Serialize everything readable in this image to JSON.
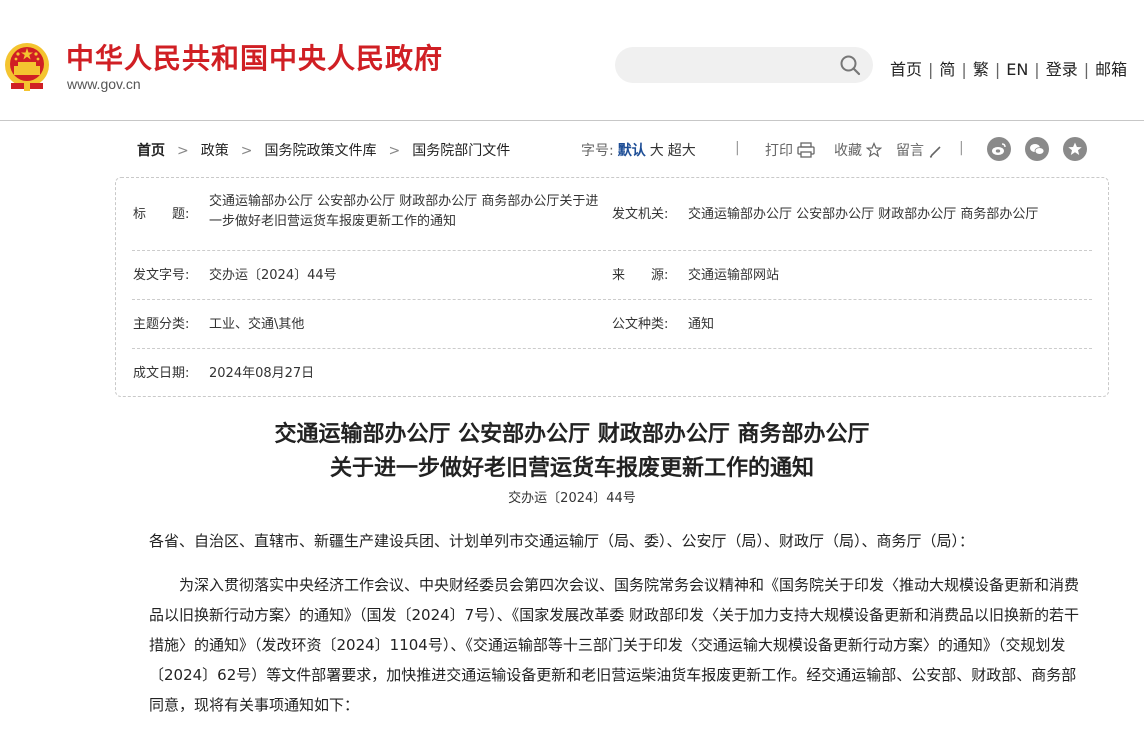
{
  "header": {
    "site_title": "中华人民共和国中央人民政府",
    "site_domain": "www.gov.cn",
    "search_placeholder": "",
    "top_links": [
      "首页",
      "简",
      "繁",
      "EN",
      "登录",
      "邮箱"
    ],
    "separator": "|"
  },
  "breadcrumb": {
    "items": [
      "首页",
      "政策",
      "国务院政策文件库",
      "国务院部门文件"
    ],
    "arrow": ">"
  },
  "toolbar": {
    "fontsize_label": "字号:",
    "fontsize_options": [
      "默认",
      "大",
      "超大"
    ],
    "print": "打印",
    "favorite": "收藏",
    "comment": "留言",
    "separator": "|"
  },
  "meta": {
    "title_label": "标　　题:",
    "title_value": "交通运输部办公厅 公安部办公厅 财政部办公厅 商务部办公厅关于进一步做好老旧营运货车报废更新工作的通知",
    "issuer_label": "发文机关:",
    "issuer_value": "交通运输部办公厅 公安部办公厅 财政部办公厅 商务部办公厅",
    "docno_label": "发文字号:",
    "docno_value": "交办运〔2024〕44号",
    "source_label": "来　　源:",
    "source_value": "交通运输部网站",
    "topic_label": "主题分类:",
    "topic_value": "工业、交通\\其他",
    "type_label": "公文种类:",
    "type_value": "通知",
    "date_label": "成文日期:",
    "date_value": "2024年08月27日"
  },
  "article": {
    "title_line1": "交通运输部办公厅 公安部办公厅 财政部办公厅 商务部办公厅",
    "title_line2": "关于进一步做好老旧营运货车报废更新工作的通知",
    "doc_number": "交办运〔2024〕44号",
    "para1": "各省、自治区、直辖市、新疆生产建设兵团、计划单列市交通运输厅（局、委）、公安厅（局）、财政厅（局）、商务厅（局）：",
    "para2": "为深入贯彻落实中央经济工作会议、中央财经委员会第四次会议、国务院常务会议精神和《国务院关于印发〈推动大规模设备更新和消费品以旧换新行动方案〉的通知》（国发〔2024〕7号）、《国家发展改革委 财政部印发〈关于加力支持大规模设备更新和消费品以旧换新的若干措施〉的通知》（发改环资〔2024〕1104号）、《交通运输部等十三部门关于印发〈交通运输大规模设备更新行动方案〉的通知》（交规划发〔2024〕62号）等文件部署要求，加快推进交通运输设备更新和老旧营运柴油货车报废更新工作。经交通运输部、公安部、财政部、商务部同意，现将有关事项通知如下："
  },
  "colors": {
    "brand_red": "#d01f24",
    "active_blue": "#1e4e96",
    "emblem_gold": "#f4c430"
  }
}
